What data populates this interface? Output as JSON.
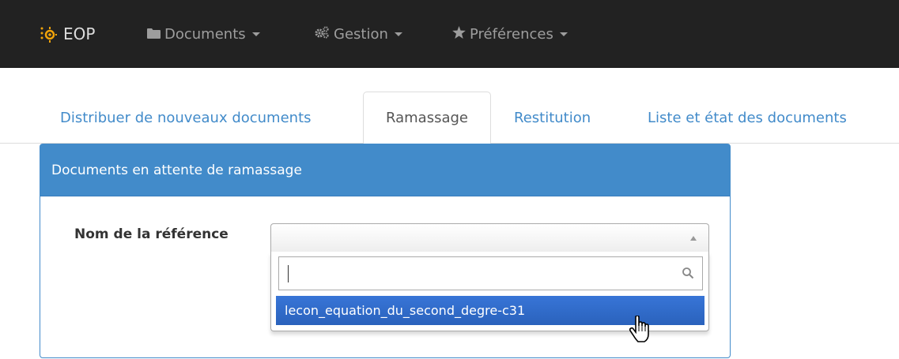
{
  "navbar": {
    "brand": "EOP",
    "items": [
      {
        "label": "Documents",
        "icon": "folder-icon"
      },
      {
        "label": "Gestion",
        "icon": "gears-icon"
      },
      {
        "label": "Préférences",
        "icon": "star-icon"
      }
    ]
  },
  "tabs": [
    {
      "label": "Distribuer de nouveaux documents",
      "active": false
    },
    {
      "label": "Ramassage",
      "active": true
    },
    {
      "label": "Restitution",
      "active": false
    },
    {
      "label": "Liste et état des documents",
      "active": false
    }
  ],
  "panel": {
    "heading": "Documents en attente de ramassage",
    "field_label": "Nom de la référence"
  },
  "select": {
    "selected_value": "",
    "search_value": "",
    "options": [
      "lecon_equation_du_second_degre-c31"
    ]
  },
  "colors": {
    "navbar_bg": "#222222",
    "accent": "#428bca",
    "highlight": "#3875d7",
    "logo": "#f0a30a"
  }
}
